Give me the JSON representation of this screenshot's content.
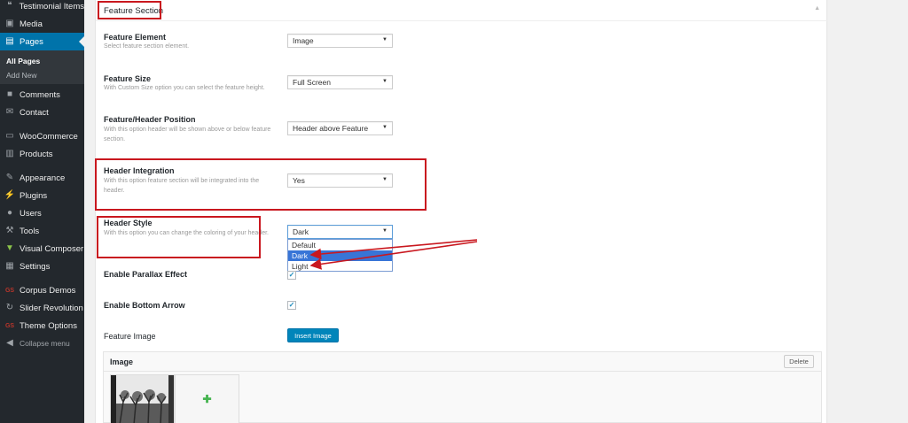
{
  "sidebar": {
    "items": [
      {
        "label": "Testimonial Items",
        "icon": "quote-icon"
      },
      {
        "label": "Media",
        "icon": "media-icon"
      },
      {
        "label": "Pages",
        "icon": "pages-icon"
      },
      {
        "label": "Comments",
        "icon": "comments-icon"
      },
      {
        "label": "Contact",
        "icon": "mail-icon"
      },
      {
        "label": "WooCommerce",
        "icon": "woocommerce-icon"
      },
      {
        "label": "Products",
        "icon": "products-icon"
      },
      {
        "label": "Appearance",
        "icon": "brush-icon"
      },
      {
        "label": "Plugins",
        "icon": "plugin-icon"
      },
      {
        "label": "Users",
        "icon": "user-icon"
      },
      {
        "label": "Tools",
        "icon": "wrench-icon"
      },
      {
        "label": "Visual Composer",
        "icon": "visual-composer-icon"
      },
      {
        "label": "Settings",
        "icon": "settings-icon"
      },
      {
        "label": "Corpus Demos",
        "icon": "corpus-logo-icon"
      },
      {
        "label": "Slider Revolution",
        "icon": "slider-revolution-icon"
      },
      {
        "label": "Theme Options",
        "icon": "corpus-logo-icon"
      }
    ],
    "submenu": [
      "All Pages",
      "Add New"
    ],
    "collapse_label": "Collapse menu",
    "brand_mark": "GS"
  },
  "panel": {
    "title": "Feature Section",
    "fields": {
      "feature_element": {
        "label": "Feature Element",
        "desc": "Select feature section element.",
        "value": "Image"
      },
      "feature_size": {
        "label": "Feature Size",
        "desc": "With Custom Size option you can select the feature height.",
        "value": "Full Screen"
      },
      "header_position": {
        "label": "Feature/Header Position",
        "desc": "With this option header will be shown above or below feature section.",
        "value": "Header above Feature"
      },
      "header_integration": {
        "label": "Header Integration",
        "desc": "With this option feature section will be integrated into the header.",
        "value": "Yes"
      },
      "header_style": {
        "label": "Header Style",
        "desc": "With this option you can change the coloring of your header.",
        "value": "Dark",
        "options": [
          "Default",
          "Dark",
          "Light"
        ]
      }
    },
    "parallax_label": "Enable Parallax Effect",
    "bottom_arrow_label": "Enable Bottom Arrow",
    "feature_image_label": "Feature Image",
    "insert_image_label": "Insert Image",
    "image_box_title": "Image",
    "delete_label": "Delete"
  },
  "colors": {
    "accent": "#0073aa",
    "annotation": "#c9181f",
    "dropdown_highlight": "#3875d7"
  }
}
